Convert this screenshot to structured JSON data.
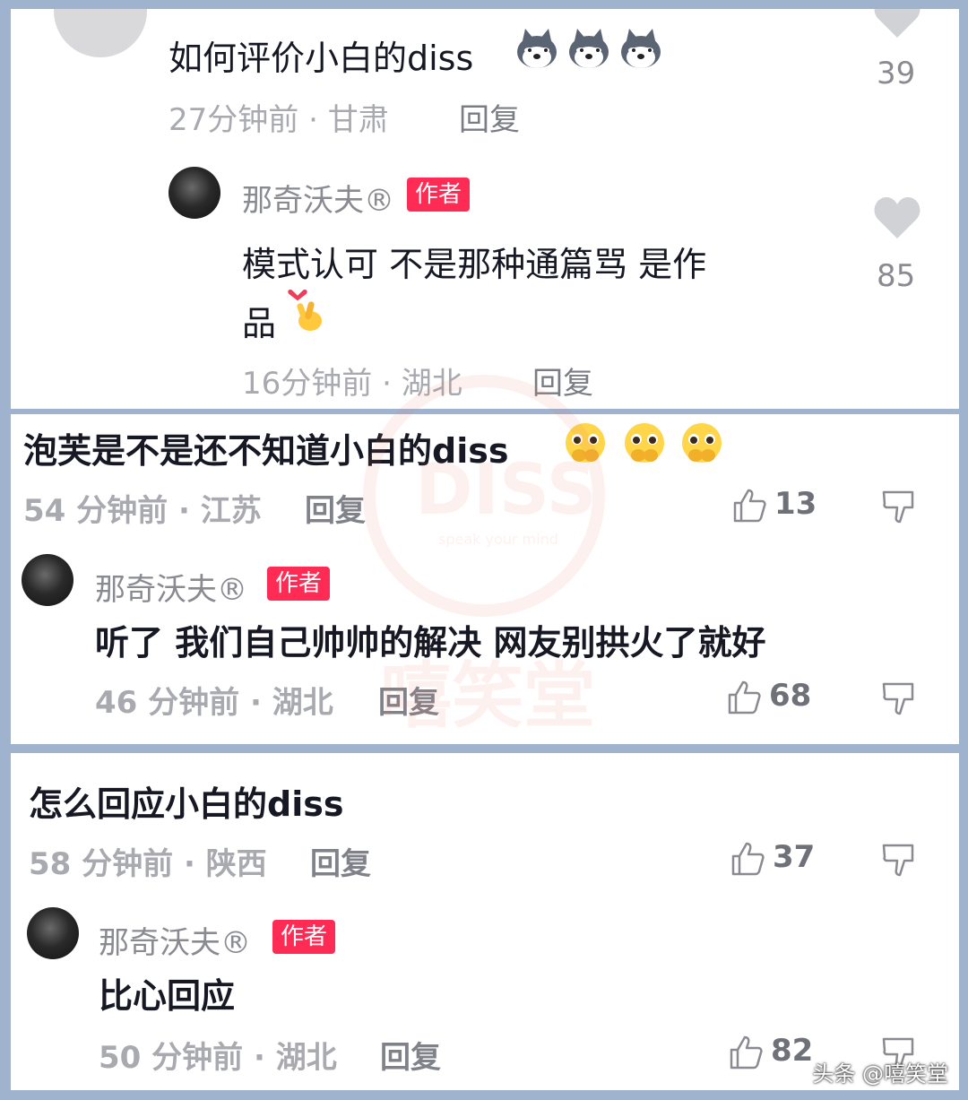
{
  "comments": [
    {
      "text": "如何评价小白的diss",
      "time": "27分钟前",
      "location": "甘肃",
      "reply_label": "回复",
      "likes": "39",
      "emoji": "wolf-emoji",
      "author_reply": {
        "name": "那奇沃夫®",
        "badge": "作者",
        "text_line1": "模式认可   不是那种通篇骂   是作",
        "text_line2": "品",
        "emoji": "heart-hand-emoji",
        "time": "16分钟前",
        "location": "湖北",
        "reply_label": "回复",
        "likes": "85"
      }
    },
    {
      "text": "泡芙是不是还不知道小白的diss",
      "time": "54 分钟前",
      "location": "江苏",
      "reply_label": "回复",
      "likes": "13",
      "emoji": "pleading-emoji",
      "author_reply": {
        "name": "那奇沃夫®",
        "badge": "作者",
        "text": "听了   我们自己帅帅的解决   网友别拱火了就好",
        "time": "46 分钟前",
        "location": "湖北",
        "reply_label": "回复",
        "likes": "68"
      }
    },
    {
      "text": "怎么回应小白的diss",
      "time": "58 分钟前",
      "location": "陕西",
      "reply_label": "回复",
      "likes": "37",
      "author_reply": {
        "name": "那奇沃夫®",
        "badge": "作者",
        "text": "比心回应",
        "time": "50 分钟前",
        "location": "湖北",
        "reply_label": "回复",
        "likes": "82"
      }
    }
  ],
  "watermark": {
    "circle_text": "DISS",
    "tagline": "speak your mind",
    "brand": "嘻笑堂"
  },
  "footer": "头条 @嘻笑堂",
  "colors": {
    "badge": "#fe2c55",
    "frame": "#9fb3cf",
    "meta": "#a8aab0"
  }
}
